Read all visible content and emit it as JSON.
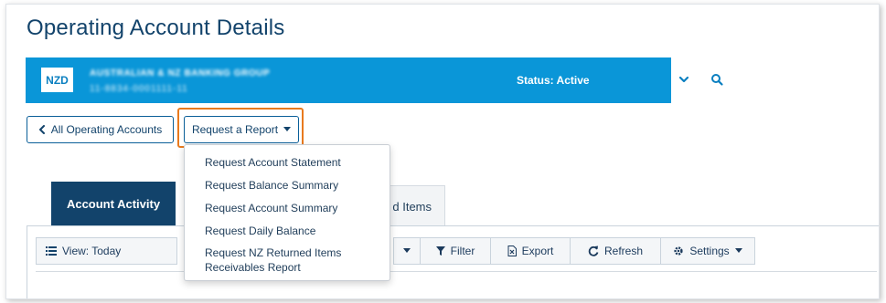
{
  "page": {
    "title": "Operating Account Details"
  },
  "account": {
    "currency": "NZD",
    "name": "AUSTRALIAN & NZ BANKING GROUP",
    "number": "11-8834-0001111-11",
    "status": "Status: Active"
  },
  "actions": {
    "back_label": "All Operating Accounts",
    "report_label": "Request a Report"
  },
  "report_menu": [
    "Request Account Statement",
    "Request Balance Summary",
    "Request Account Summary",
    "Request Daily Balance",
    "Request NZ Returned Items Receivables Report"
  ],
  "tabs": {
    "active": "Account Activity",
    "partial": "d Items"
  },
  "toolbar": {
    "view": "View: Today",
    "filter": "Filter",
    "export": "Export",
    "refresh": "Refresh",
    "settings": "Settings"
  },
  "colors": {
    "accent_blue": "#0a96d8",
    "navy": "#12436b",
    "highlight_orange": "#e87a1e"
  },
  "icons": [
    "chevron-down-icon",
    "search-icon",
    "chevron-left-icon",
    "caret-down-icon",
    "list-icon",
    "filter-icon",
    "export-icon",
    "refresh-icon",
    "gear-icon"
  ]
}
